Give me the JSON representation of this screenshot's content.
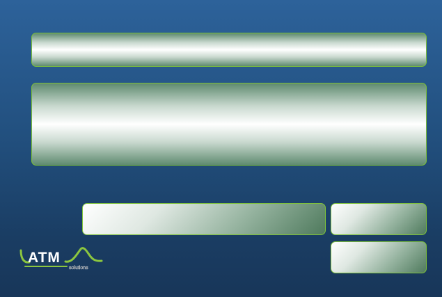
{
  "app": {
    "title": ""
  },
  "header": {
    "text": ""
  },
  "content": {
    "text": ""
  },
  "form": {
    "input_value": "",
    "input_placeholder": "",
    "primary_button_label": "",
    "secondary_button_label": ""
  },
  "logo": {
    "wordmark": "ATM",
    "tagline": "solutions"
  },
  "colors": {
    "background_top": "#2d629a",
    "background_bottom": "#183659",
    "panel_border": "#7ec23a",
    "panel_dark": "#4f7a5d",
    "logo_accent": "#8cc63f"
  }
}
